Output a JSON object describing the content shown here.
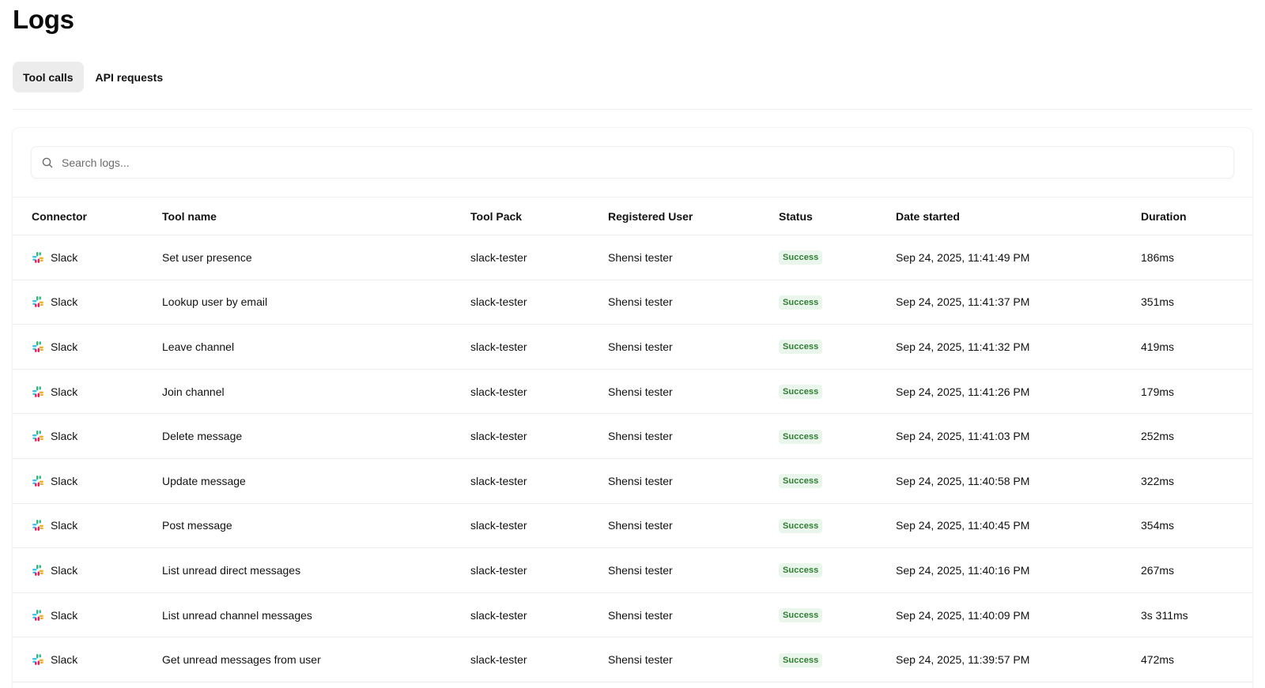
{
  "page": {
    "title": "Logs"
  },
  "tabs": [
    {
      "label": "Tool calls",
      "active": true
    },
    {
      "label": "API requests",
      "active": false
    }
  ],
  "search": {
    "placeholder": "Search logs...",
    "value": ""
  },
  "table": {
    "columns": [
      "Connector",
      "Tool name",
      "Tool Pack",
      "Registered User",
      "Status",
      "Date started",
      "Duration"
    ],
    "rows": [
      {
        "connector": "Slack",
        "tool_name": "Set user presence",
        "tool_pack": "slack-tester",
        "user": "Shensi tester",
        "status": "Success",
        "date": "Sep 24, 2025, 11:41:49 PM",
        "duration": "186ms"
      },
      {
        "connector": "Slack",
        "tool_name": "Lookup user by email",
        "tool_pack": "slack-tester",
        "user": "Shensi tester",
        "status": "Success",
        "date": "Sep 24, 2025, 11:41:37 PM",
        "duration": "351ms"
      },
      {
        "connector": "Slack",
        "tool_name": "Leave channel",
        "tool_pack": "slack-tester",
        "user": "Shensi tester",
        "status": "Success",
        "date": "Sep 24, 2025, 11:41:32 PM",
        "duration": "419ms"
      },
      {
        "connector": "Slack",
        "tool_name": "Join channel",
        "tool_pack": "slack-tester",
        "user": "Shensi tester",
        "status": "Success",
        "date": "Sep 24, 2025, 11:41:26 PM",
        "duration": "179ms"
      },
      {
        "connector": "Slack",
        "tool_name": "Delete message",
        "tool_pack": "slack-tester",
        "user": "Shensi tester",
        "status": "Success",
        "date": "Sep 24, 2025, 11:41:03 PM",
        "duration": "252ms"
      },
      {
        "connector": "Slack",
        "tool_name": "Update message",
        "tool_pack": "slack-tester",
        "user": "Shensi tester",
        "status": "Success",
        "date": "Sep 24, 2025, 11:40:58 PM",
        "duration": "322ms"
      },
      {
        "connector": "Slack",
        "tool_name": "Post message",
        "tool_pack": "slack-tester",
        "user": "Shensi tester",
        "status": "Success",
        "date": "Sep 24, 2025, 11:40:45 PM",
        "duration": "354ms"
      },
      {
        "connector": "Slack",
        "tool_name": "List unread direct messages",
        "tool_pack": "slack-tester",
        "user": "Shensi tester",
        "status": "Success",
        "date": "Sep 24, 2025, 11:40:16 PM",
        "duration": "267ms"
      },
      {
        "connector": "Slack",
        "tool_name": "List unread channel messages",
        "tool_pack": "slack-tester",
        "user": "Shensi tester",
        "status": "Success",
        "date": "Sep 24, 2025, 11:40:09 PM",
        "duration": "3s 311ms"
      },
      {
        "connector": "Slack",
        "tool_name": "Get unread messages from user",
        "tool_pack": "slack-tester",
        "user": "Shensi tester",
        "status": "Success",
        "date": "Sep 24, 2025, 11:39:57 PM",
        "duration": "472ms"
      }
    ]
  },
  "icons": {
    "search": "search-icon",
    "connector": "slack-icon"
  },
  "colors": {
    "success_bg": "#eaf6ec",
    "success_text": "#2e7d32",
    "tab_active_bg": "#ececec",
    "slack_blue": "#36C5F0",
    "slack_green": "#2EB67D",
    "slack_yellow": "#ECB22E",
    "slack_red": "#E01E5A"
  }
}
